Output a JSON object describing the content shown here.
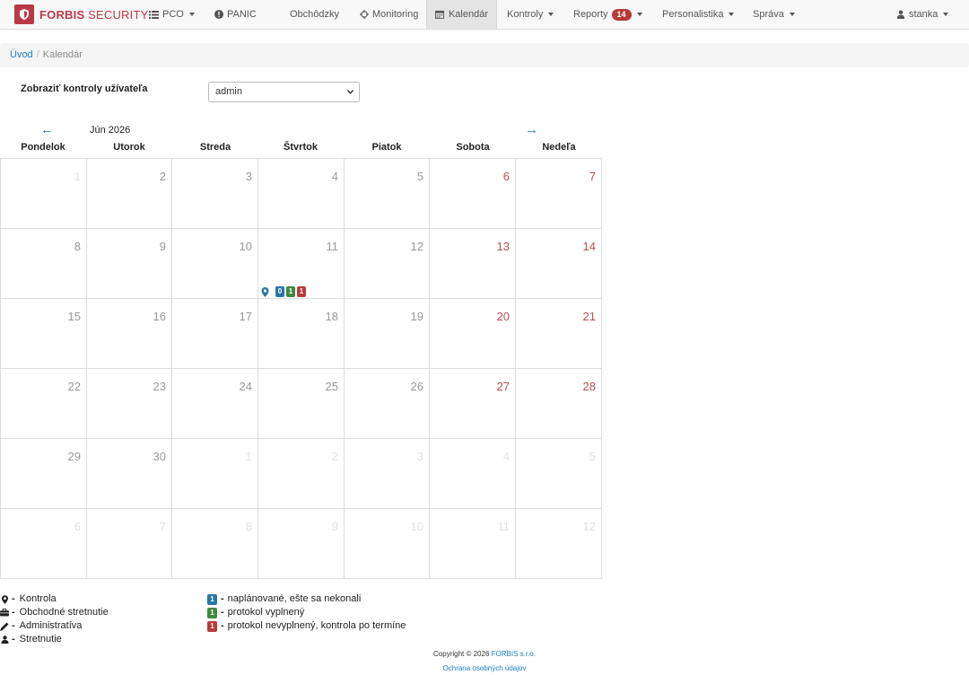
{
  "brand": {
    "bold": "FORBIS",
    "rest": " SECURITY",
    "color": "#b83a48"
  },
  "nav": {
    "pco": "PCO",
    "panic": "PANIC",
    "obchodzky": "Obchôdzky",
    "monitoring": "Monitoring",
    "kalendar": "Kalendár",
    "kontroly": "Kontroly",
    "reporty": "Reporty",
    "reporty_badge": "14",
    "personalistika": "Personalistika",
    "sprava": "Správa",
    "user": "stanka"
  },
  "breadcrumb": {
    "home": "Úvod",
    "current": "Kalendár"
  },
  "filter": {
    "label": "Zobraziť kontroly užívateľa",
    "selected": "admin"
  },
  "calendar": {
    "prev": "←",
    "next": "→",
    "month": "Jún 2026",
    "weekdays": [
      "Pondelok",
      "Utorok",
      "Streda",
      "Štvrtok",
      "Piatok",
      "Sobota",
      "Nedeľa"
    ],
    "weeks": [
      [
        "1",
        "2",
        "3",
        "4",
        "5",
        "6",
        "7"
      ],
      [
        "8",
        "9",
        "10",
        "11",
        "12",
        "13",
        "14"
      ],
      [
        "15",
        "16",
        "17",
        "18",
        "19",
        "20",
        "21"
      ],
      [
        "22",
        "23",
        "24",
        "25",
        "26",
        "27",
        "28"
      ],
      [
        "29",
        "30",
        "1",
        "2",
        "3",
        "4",
        "5"
      ],
      [
        "6",
        "7",
        "8",
        "9",
        "10",
        "11",
        "12"
      ]
    ],
    "event": {
      "planned": "0",
      "filled": "1",
      "overdue": "1"
    }
  },
  "legend": {
    "types": [
      {
        "icon": "map-pin-icon",
        "label": "Kontrola"
      },
      {
        "icon": "briefcase-icon",
        "label": "Obchodné stretnutie"
      },
      {
        "icon": "pencil-icon",
        "label": "Administratíva"
      },
      {
        "icon": "user-icon",
        "label": "Stretnutie"
      }
    ],
    "statuses": [
      {
        "count": "1",
        "color": "#2b76a8",
        "label": "naplánované, ešte sa nekonali"
      },
      {
        "count": "1",
        "color": "#3e8a3e",
        "label": "protokol vyplnený"
      },
      {
        "count": "1",
        "color": "#b83a3a",
        "label": "protokol nevyplnený, kontrola po termíne"
      }
    ],
    "dash": "-"
  },
  "footer": {
    "copyright": "Copyright © 2026",
    "company": "FORBIS s.r.o.",
    "privacy": "Ochrana osobných údajov"
  }
}
